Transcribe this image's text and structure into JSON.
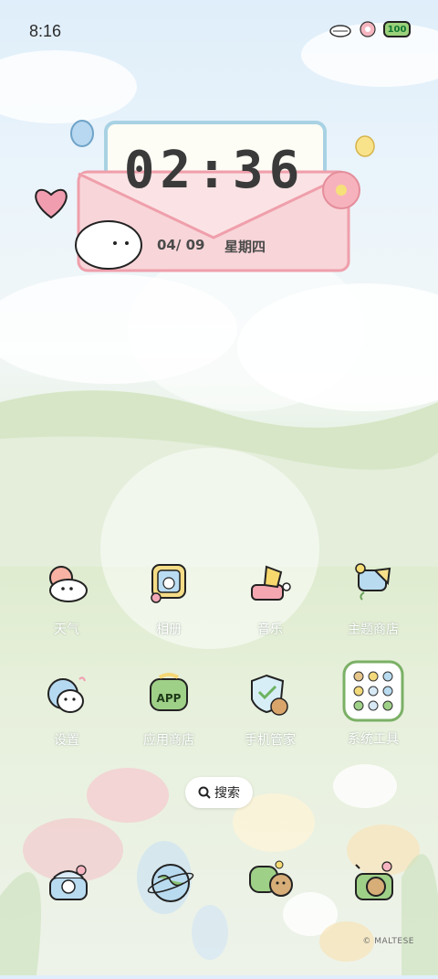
{
  "status_bar": {
    "time": "8:16",
    "battery_label": "100"
  },
  "clock_widget": {
    "time": "02:36",
    "date": "04/ 09",
    "weekday": "星期四"
  },
  "apps": [
    {
      "label": "天气",
      "icon": "weather-icon"
    },
    {
      "label": "相册",
      "icon": "gallery-icon"
    },
    {
      "label": "音乐",
      "icon": "music-icon"
    },
    {
      "label": "主题商店",
      "icon": "theme-store-icon"
    },
    {
      "label": "设置",
      "icon": "settings-icon"
    },
    {
      "label": "应用商店",
      "icon": "app-store-icon"
    },
    {
      "label": "手机管家",
      "icon": "phone-manager-icon"
    },
    {
      "label": "系统工具",
      "icon": "system-tools-folder-icon"
    }
  ],
  "app_store_badge": "APP",
  "search": {
    "label": "搜索"
  },
  "dock": [
    {
      "icon": "phone-icon"
    },
    {
      "icon": "browser-globe-icon"
    },
    {
      "icon": "messages-icon"
    },
    {
      "icon": "camera-icon"
    }
  ],
  "credit": "© MALTESE"
}
